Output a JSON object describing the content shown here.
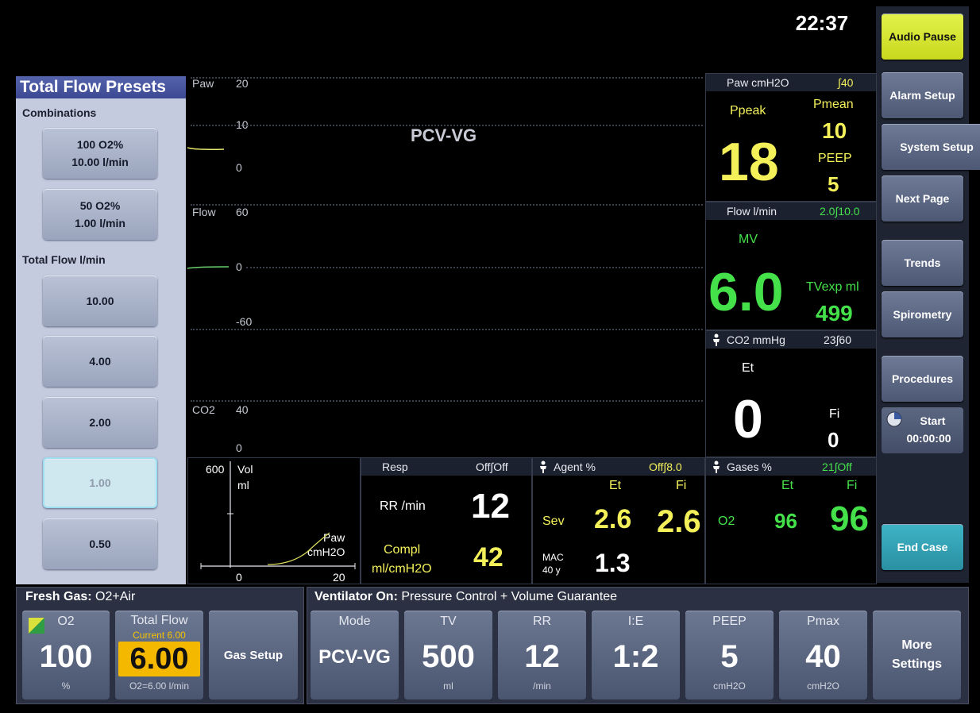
{
  "clock": "22:37",
  "presets": {
    "title": "Total Flow Presets",
    "combinations_label": "Combinations",
    "combo": [
      {
        "line1": "100 O2%",
        "line2": "10.00 l/min"
      },
      {
        "line1": "50 O2%",
        "line2": "1.00 l/min"
      }
    ],
    "total_flow_label": "Total Flow l/min",
    "flows": [
      "10.00",
      "4.00",
      "2.00",
      "1.00",
      "0.50"
    ]
  },
  "waves": {
    "paw": {
      "name": "Paw",
      "top": "20",
      "mid": "10",
      "bot": "0"
    },
    "flow": {
      "name": "Flow",
      "top": "60",
      "mid": "0",
      "bot": "-60"
    },
    "co2": {
      "name": "CO2",
      "top": "40",
      "bot": "0"
    },
    "mode_label": "PCV-VG"
  },
  "loop": {
    "ytop": "600",
    "ylabel1": "Vol",
    "ylabel2": "ml",
    "xlabel1": "Paw",
    "xlabel2": "cmH2O",
    "x0": "0",
    "x1": "20"
  },
  "paw_panel": {
    "title": "Paw cmH2O",
    "limit": "∫40",
    "ppeak_label": "Ppeak",
    "ppeak": "18",
    "pmean_label": "Pmean",
    "pmean": "10",
    "peep_label": "PEEP",
    "peep": "5"
  },
  "flow_panel": {
    "title": "Flow l/min",
    "limit": "2.0∫10.0",
    "mv_label": "MV",
    "mv": "6.0",
    "tv_label": "TVexp ml",
    "tv": "499"
  },
  "co2_panel": {
    "title": "CO2 mmHg",
    "limit": "23∫60",
    "et_label": "Et",
    "et": "0",
    "fi_label": "Fi",
    "fi": "0"
  },
  "resp_panel": {
    "title": "Resp",
    "limit": "Off∫Off",
    "rr_label": "RR /min",
    "rr": "12",
    "compl_label1": "Compl",
    "compl_label2": "ml/cmH2O",
    "compl": "42"
  },
  "agent_panel": {
    "title": "Agent %",
    "limit": "Off∫8.0",
    "et_label": "Et",
    "fi_label": "Fi",
    "agent": "Sev",
    "et": "2.6",
    "fi": "2.6",
    "mac_label1": "MAC",
    "mac_label2": "40 y",
    "mac": "1.3"
  },
  "gases_panel": {
    "title": "Gases %",
    "limit": "21∫Off",
    "et_label": "Et",
    "fi_label": "Fi",
    "gas": "O2",
    "et": "96",
    "fi": "96"
  },
  "right_buttons": [
    "Audio Pause",
    "Alarm Setup",
    "System Setup",
    "Next Page",
    "Trends",
    "Spirometry",
    "Procedures",
    "End Case"
  ],
  "timer": {
    "label": "Start",
    "value": "00:00:00"
  },
  "fresh_gas": {
    "title": "Fresh Gas:",
    "value": "O2+Air",
    "o2": {
      "label": "O2",
      "value": "100",
      "unit": "%"
    },
    "total_flow": {
      "label": "Total Flow",
      "current": "Current 6.00",
      "value": "6.00",
      "sub": "O2=6.00 l/min"
    },
    "gas_setup": "Gas Setup"
  },
  "ventilator": {
    "title": "Ventilator On:",
    "value": "Pressure Control + Volume Guarantee",
    "settings": [
      {
        "label": "Mode",
        "value": "PCV-VG",
        "unit": ""
      },
      {
        "label": "TV",
        "value": "500",
        "unit": "ml"
      },
      {
        "label": "RR",
        "value": "12",
        "unit": "/min"
      },
      {
        "label": "I:E",
        "value": "1:2",
        "unit": ""
      },
      {
        "label": "PEEP",
        "value": "5",
        "unit": "cmH2O"
      },
      {
        "label": "Pmax",
        "value": "40",
        "unit": "cmH2O"
      }
    ],
    "more": "More Settings"
  },
  "colors": {
    "yellow": "#f3f05a",
    "green": "#44e14a",
    "accent_yellow_button": "#d6e535",
    "teal_button": "#35a3b5"
  }
}
